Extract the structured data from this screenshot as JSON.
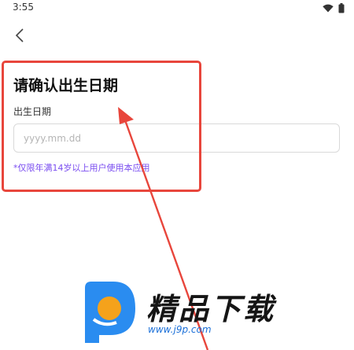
{
  "status_bar": {
    "time": "3:55"
  },
  "header": {
    "back_icon": "chevron-left-icon"
  },
  "main": {
    "title": "请确认出生日期",
    "birth_label": "出生日期",
    "date_placeholder": "yyyy.mm.dd",
    "notice": "*仅限年满14岁以上用户使用本应用"
  },
  "watermark": {
    "title": "精品下载",
    "url": "www.j9p.com",
    "logo_icon": "j9p-logo-icon"
  },
  "colors": {
    "annotation": "#e8463c",
    "notice": "#7a4df0",
    "watermark_blue": "#2a8cf0",
    "watermark_orange": "#f5a21b"
  }
}
